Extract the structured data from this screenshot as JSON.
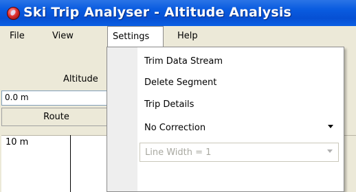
{
  "window": {
    "title": "Ski Trip Analyser - Altitude Analysis"
  },
  "menubar": {
    "items": [
      {
        "label": "File"
      },
      {
        "label": "View"
      },
      {
        "label": "Settings"
      },
      {
        "label": "Help"
      }
    ]
  },
  "panel": {
    "altitude_label": "Altitude",
    "altitude_value": "0.0 m",
    "route_button": "Route",
    "plot_label": "10 m"
  },
  "settings_menu": {
    "items": [
      {
        "label": "Trim Data Stream"
      },
      {
        "label": "Delete Segment"
      },
      {
        "label": "Trip Details"
      }
    ],
    "correction_combo": {
      "value": "No Correction",
      "enabled": true
    },
    "line_width_combo": {
      "value": "Line Width = 1",
      "enabled": false
    }
  }
}
